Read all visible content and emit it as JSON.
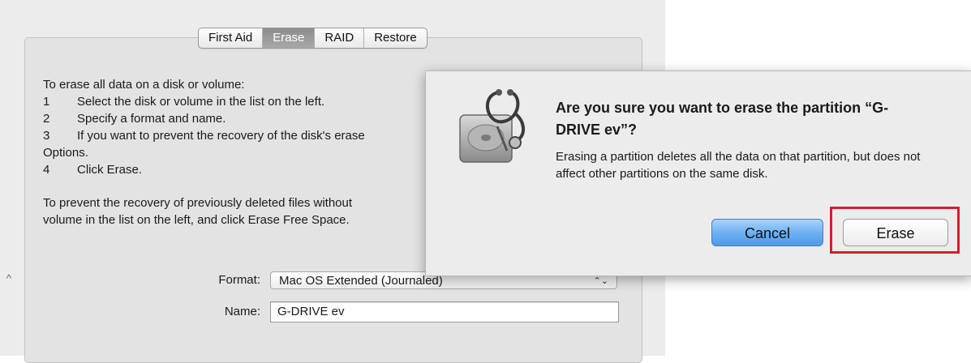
{
  "tabs": [
    "First Aid",
    "Erase",
    "RAID",
    "Restore"
  ],
  "active_tab": "Erase",
  "instructions": {
    "intro": "To erase all data on a disk or volume:",
    "steps": [
      {
        "num": "1",
        "text": "Select the disk or volume in the list on the left."
      },
      {
        "num": "2",
        "text": "Specify a format and name."
      },
      {
        "num": "3",
        "text": "If you want to prevent the recovery of the disk's erase"
      },
      {
        "num": "",
        "text": "Options."
      },
      {
        "num": "4",
        "text": "Click Erase."
      }
    ],
    "free_space_line1": "To prevent the recovery of previously deleted files without",
    "free_space_line2": "volume in the list on the left, and click Erase Free Space."
  },
  "format": {
    "label": "Format:",
    "value": "Mac OS Extended (Journaled)",
    "arrows": "⌃⌄"
  },
  "name": {
    "label": "Name:",
    "value": "G-DRIVE ev"
  },
  "small_mark": "^",
  "alert": {
    "title": "Are you sure you want to erase the partition “G-DRIVE ev”?",
    "message": "Erasing a partition deletes all the data on that partition, but does not affect other partitions on the same disk.",
    "cancel_label": "Cancel",
    "erase_label": "Erase",
    "icon": "disk-utility-icon"
  },
  "highlight_color": "#d0202d",
  "accent_color": "#5aa4ee"
}
